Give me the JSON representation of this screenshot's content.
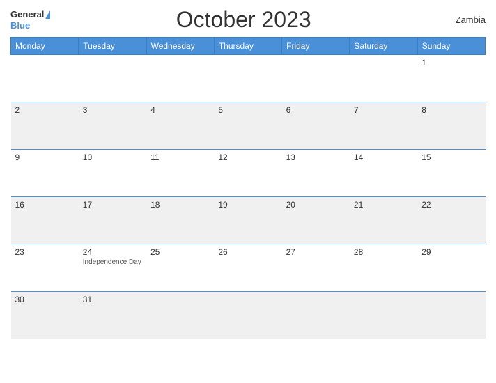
{
  "header": {
    "logo_top": "General",
    "logo_bottom": "Blue",
    "title": "October 2023",
    "country": "Zambia"
  },
  "days_of_week": [
    "Monday",
    "Tuesday",
    "Wednesday",
    "Thursday",
    "Friday",
    "Saturday",
    "Sunday"
  ],
  "weeks": [
    [
      {
        "date": "",
        "events": []
      },
      {
        "date": "",
        "events": []
      },
      {
        "date": "",
        "events": []
      },
      {
        "date": "",
        "events": []
      },
      {
        "date": "",
        "events": []
      },
      {
        "date": "",
        "events": []
      },
      {
        "date": "1",
        "events": []
      }
    ],
    [
      {
        "date": "2",
        "events": []
      },
      {
        "date": "3",
        "events": []
      },
      {
        "date": "4",
        "events": []
      },
      {
        "date": "5",
        "events": []
      },
      {
        "date": "6",
        "events": []
      },
      {
        "date": "7",
        "events": []
      },
      {
        "date": "8",
        "events": []
      }
    ],
    [
      {
        "date": "9",
        "events": []
      },
      {
        "date": "10",
        "events": []
      },
      {
        "date": "11",
        "events": []
      },
      {
        "date": "12",
        "events": []
      },
      {
        "date": "13",
        "events": []
      },
      {
        "date": "14",
        "events": []
      },
      {
        "date": "15",
        "events": []
      }
    ],
    [
      {
        "date": "16",
        "events": []
      },
      {
        "date": "17",
        "events": []
      },
      {
        "date": "18",
        "events": []
      },
      {
        "date": "19",
        "events": []
      },
      {
        "date": "20",
        "events": []
      },
      {
        "date": "21",
        "events": []
      },
      {
        "date": "22",
        "events": []
      }
    ],
    [
      {
        "date": "23",
        "events": []
      },
      {
        "date": "24",
        "events": [
          "Independence Day"
        ]
      },
      {
        "date": "25",
        "events": []
      },
      {
        "date": "26",
        "events": []
      },
      {
        "date": "27",
        "events": []
      },
      {
        "date": "28",
        "events": []
      },
      {
        "date": "29",
        "events": []
      }
    ],
    [
      {
        "date": "30",
        "events": []
      },
      {
        "date": "31",
        "events": []
      },
      {
        "date": "",
        "events": []
      },
      {
        "date": "",
        "events": []
      },
      {
        "date": "",
        "events": []
      },
      {
        "date": "",
        "events": []
      },
      {
        "date": "",
        "events": []
      }
    ]
  ]
}
